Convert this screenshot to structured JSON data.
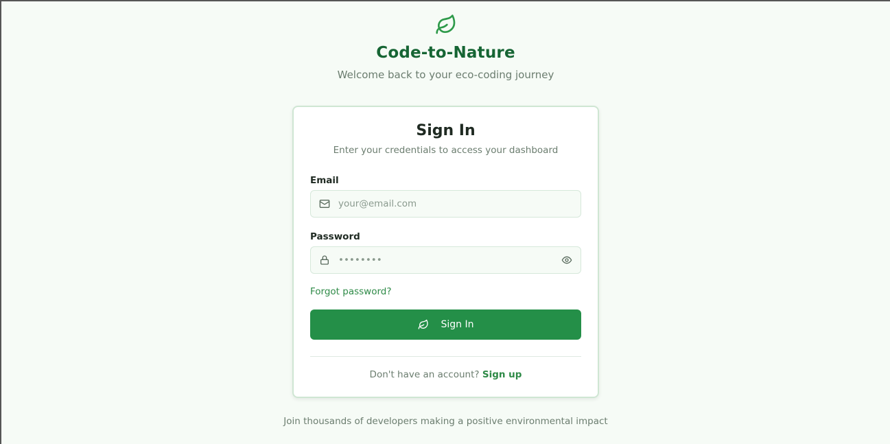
{
  "brand": {
    "icon": "leaf-icon",
    "title": "Code-to-Nature",
    "subtitle": "Welcome back to your eco-coding journey"
  },
  "card": {
    "title": "Sign In",
    "subtitle": "Enter your credentials to access your dashboard",
    "email": {
      "label": "Email",
      "icon": "mail-icon",
      "placeholder": "your@email.com",
      "value": ""
    },
    "password": {
      "label": "Password",
      "icon": "lock-icon",
      "toggle_icon": "eye-icon",
      "placeholder": "••••••••",
      "value": ""
    },
    "forgot_label": "Forgot password?",
    "submit": {
      "icon": "leaf-icon",
      "label": "Sign In"
    },
    "signup": {
      "prompt": "Don't have an account?",
      "link_label": "Sign up"
    }
  },
  "footer": {
    "note": "Join thousands of developers making a positive environmental impact"
  },
  "colors": {
    "background": "#f6fbf6",
    "brand_green": "#166534",
    "accent_green": "#248f48",
    "link_green": "#2e8a47"
  }
}
